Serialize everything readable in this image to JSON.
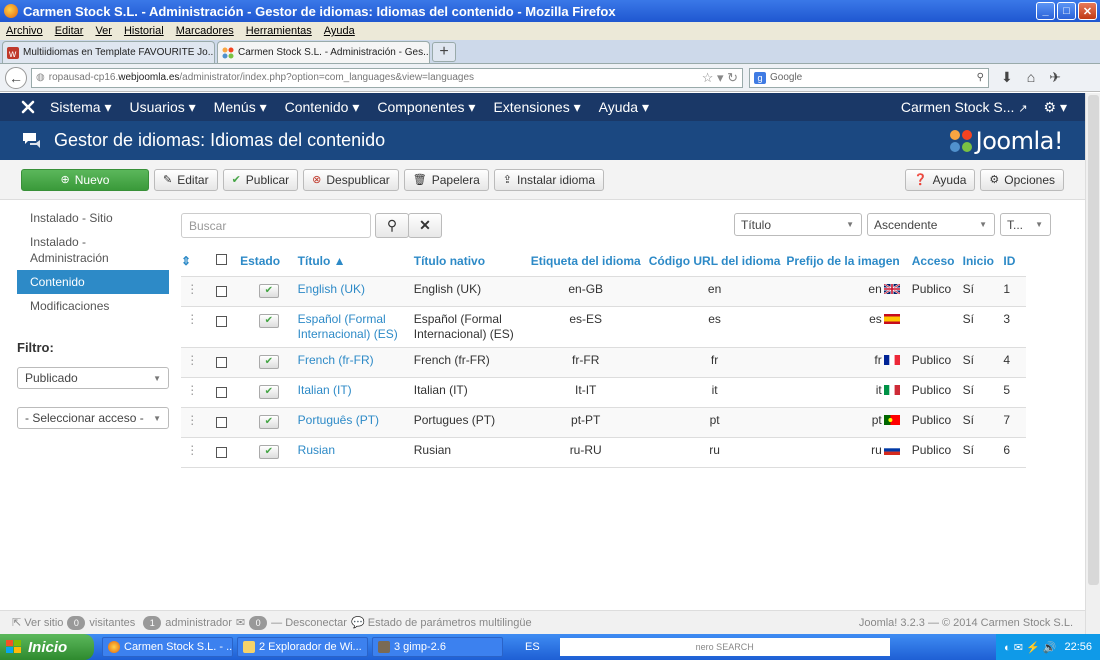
{
  "browser": {
    "window_title": "Carmen Stock S.L. - Administración - Gestor de idiomas: Idiomas del contenido - Mozilla Firefox",
    "menu": [
      "Archivo",
      "Editar",
      "Ver",
      "Historial",
      "Marcadores",
      "Herramientas",
      "Ayuda"
    ],
    "tabs": [
      {
        "label": "Multiidiomas en Template FAVOURITE Jo..."
      },
      {
        "label": "Carmen Stock S.L. - Administración - Ges..."
      }
    ],
    "url_prefix": "ropausad-cp16.",
    "url_domain": "webjoomla.es",
    "url_path": "/administrator/index.php?option=com_languages&view=languages",
    "search_placeholder": "Google",
    "search_engine_badge": "g"
  },
  "joomla": {
    "top_menu": [
      "Sistema ▾",
      "Usuarios ▾",
      "Menús ▾",
      "Contenido ▾",
      "Componentes ▾",
      "Extensiones ▾",
      "Ayuda ▾"
    ],
    "site_name": "Carmen Stock S...",
    "page_title": "Gestor de idiomas: Idiomas del contenido",
    "brand": "Joomla!",
    "toolbar": {
      "nuevo": "Nuevo",
      "editar": "Editar",
      "publicar": "Publicar",
      "despublicar": "Despublicar",
      "papelera": "Papelera",
      "instalar": "Instalar idioma",
      "ayuda": "Ayuda",
      "opciones": "Opciones"
    },
    "sidebar": {
      "items": [
        "Instalado - Sitio",
        "Instalado - Administración",
        "Contenido",
        "Modificaciones"
      ],
      "filter_title": "Filtro:",
      "filter_published": "Publicado",
      "filter_access": "- Seleccionar acceso -"
    },
    "search": {
      "placeholder": "Buscar",
      "order_field": "Título",
      "order_dir": "Ascendente",
      "limit": "T..."
    },
    "table": {
      "headers": {
        "estado": "Estado",
        "titulo": "Título ▲",
        "titulo_nativo": "Título nativo",
        "etiqueta": "Etiqueta del idioma",
        "codigo": "Código URL del idioma",
        "prefijo": "Prefijo de la imagen",
        "acceso": "Acceso",
        "inicio": "Inicio",
        "id": "ID"
      },
      "rows": [
        {
          "title": "English (UK)",
          "native": "English (UK)",
          "tag": "en-GB",
          "code": "en",
          "prefix": "en",
          "flag": "uk",
          "access": "Publico",
          "home": "Sí",
          "id": "1"
        },
        {
          "title": "Español (Formal Internacional) (ES)",
          "native": "Español (Formal Internacional) (ES)",
          "tag": "es-ES",
          "code": "es",
          "prefix": "es",
          "flag": "es",
          "access": "",
          "home": "Sí",
          "id": "3"
        },
        {
          "title": "French (fr-FR)",
          "native": "French (fr-FR)",
          "tag": "fr-FR",
          "code": "fr",
          "prefix": "fr",
          "flag": "fr",
          "access": "Publico",
          "home": "Sí",
          "id": "4"
        },
        {
          "title": "Italian (IT)",
          "native": "Italian (IT)",
          "tag": "It-IT",
          "code": "it",
          "prefix": "it",
          "flag": "it",
          "access": "Publico",
          "home": "Sí",
          "id": "5"
        },
        {
          "title": "Português (PT)",
          "native": "Portugues (PT)",
          "tag": "pt-PT",
          "code": "pt",
          "prefix": "pt",
          "flag": "pt",
          "access": "Publico",
          "home": "Sí",
          "id": "7"
        },
        {
          "title": "Rusian",
          "native": "Rusian",
          "tag": "ru-RU",
          "code": "ru",
          "prefix": "ru",
          "flag": "ru",
          "access": "Publico",
          "home": "Sí",
          "id": "6"
        }
      ]
    },
    "footer": {
      "ver_sitio": "Ver sitio",
      "visitors_count": "0",
      "visitors_label": "visitantes",
      "admin_count": "1",
      "admin_label": "administrador",
      "msg_count": "0",
      "disconnect": "Desconectar",
      "multilang": "Estado de parámetros multilingüe",
      "version": "Joomla! 3.2.3 — © 2014 Carmen Stock S.L."
    }
  },
  "taskbar": {
    "start": "Inicio",
    "items": [
      "Carmen Stock S.L. - ...",
      "2 Explorador de Wi...",
      "3 gimp-2.6"
    ],
    "lang": "ES",
    "nero": "nero SEARCH",
    "clock": "22:56"
  },
  "colors": {
    "accent": "#2d8ac7",
    "nav_dark": "#1a3867",
    "header_blue": "#1b4881",
    "green": "#46a546"
  }
}
